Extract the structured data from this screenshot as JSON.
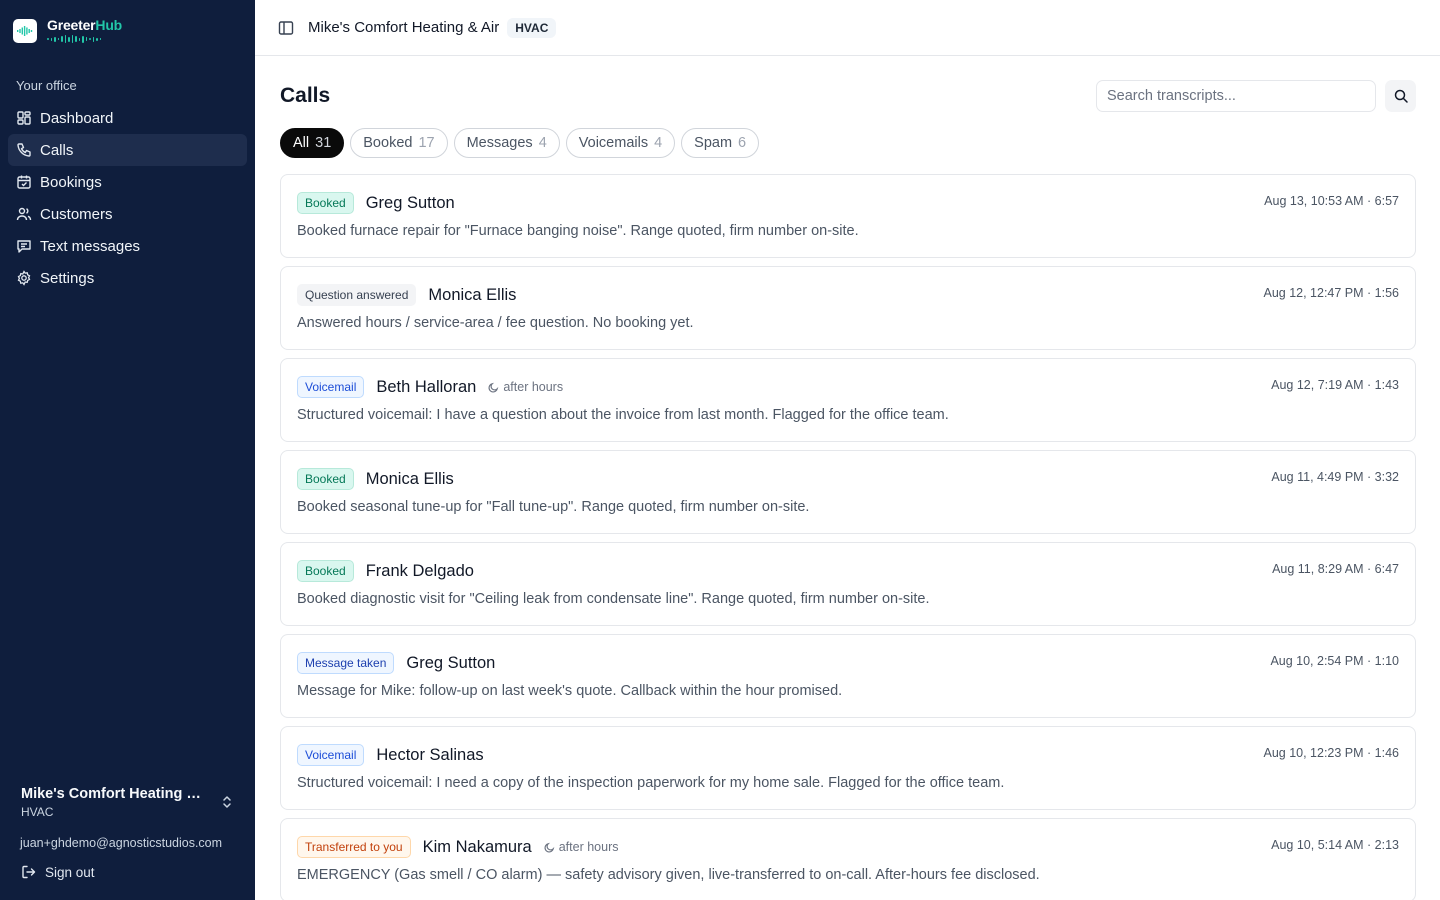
{
  "brand": {
    "name_part1": "Greeter",
    "name_part2": "Hub",
    "accent": "#22c7a9",
    "sidebar_bg": "#0f1e3d"
  },
  "sidebar": {
    "section_label": "Your office",
    "items": [
      {
        "label": "Dashboard",
        "icon": "dashboard-icon"
      },
      {
        "label": "Calls",
        "icon": "phone-icon",
        "active": true
      },
      {
        "label": "Bookings",
        "icon": "calendar-icon"
      },
      {
        "label": "Customers",
        "icon": "users-icon"
      },
      {
        "label": "Text messages",
        "icon": "message-icon"
      },
      {
        "label": "Settings",
        "icon": "gear-icon"
      }
    ],
    "org_name": "Mike's Comfort Heating & ...",
    "org_trade": "HVAC",
    "user_email": "juan+ghdemo@agnosticstudios.com",
    "sign_out": "Sign out"
  },
  "header": {
    "company": "Mike's Comfort Heating & Air",
    "trade": "HVAC"
  },
  "main": {
    "title": "Calls",
    "search_placeholder": "Search transcripts...",
    "filters": [
      {
        "label": "All",
        "count": "31",
        "active": true
      },
      {
        "label": "Booked",
        "count": "17"
      },
      {
        "label": "Messages",
        "count": "4"
      },
      {
        "label": "Voicemails",
        "count": "4"
      },
      {
        "label": "Spam",
        "count": "6"
      }
    ],
    "calls": [
      {
        "tag": "Booked",
        "tag_type": "booked",
        "caller": "Greg Sutton",
        "after_hours": "",
        "meta": "Aug 13, 10:53 AM · 6:57",
        "summary": "Booked furnace repair for \"Furnace banging noise\". Range quoted, firm number on-site."
      },
      {
        "tag": "Question answered",
        "tag_type": "question",
        "caller": "Monica Ellis",
        "after_hours": "",
        "meta": "Aug 12, 12:47 PM · 1:56",
        "summary": "Answered hours / service-area / fee question. No booking yet."
      },
      {
        "tag": "Voicemail",
        "tag_type": "voicemail",
        "caller": "Beth Halloran",
        "after_hours": "after hours",
        "meta": "Aug 12, 7:19 AM · 1:43",
        "summary": "Structured voicemail: I have a question about the invoice from last month. Flagged for the office team."
      },
      {
        "tag": "Booked",
        "tag_type": "booked",
        "caller": "Monica Ellis",
        "after_hours": "",
        "meta": "Aug 11, 4:49 PM · 3:32",
        "summary": "Booked seasonal tune-up for \"Fall tune-up\". Range quoted, firm number on-site."
      },
      {
        "tag": "Booked",
        "tag_type": "booked",
        "caller": "Frank Delgado",
        "after_hours": "",
        "meta": "Aug 11, 8:29 AM · 6:47",
        "summary": "Booked diagnostic visit for \"Ceiling leak from condensate line\". Range quoted, firm number on-site."
      },
      {
        "tag": "Message taken",
        "tag_type": "message",
        "caller": "Greg Sutton",
        "after_hours": "",
        "meta": "Aug 10, 2:54 PM · 1:10",
        "summary": "Message for Mike: follow-up on last week's quote. Callback within the hour promised."
      },
      {
        "tag": "Voicemail",
        "tag_type": "voicemail",
        "caller": "Hector Salinas",
        "after_hours": "",
        "meta": "Aug 10, 12:23 PM · 1:46",
        "summary": "Structured voicemail: I need a copy of the inspection paperwork for my home sale. Flagged for the office team."
      },
      {
        "tag": "Transferred to you",
        "tag_type": "transferred",
        "caller": "Kim Nakamura",
        "after_hours": "after hours",
        "meta": "Aug 10, 5:14 AM · 2:13",
        "summary": "EMERGENCY (Gas smell / CO alarm) — safety advisory given, live-transferred to on-call. After-hours fee disclosed."
      }
    ]
  }
}
